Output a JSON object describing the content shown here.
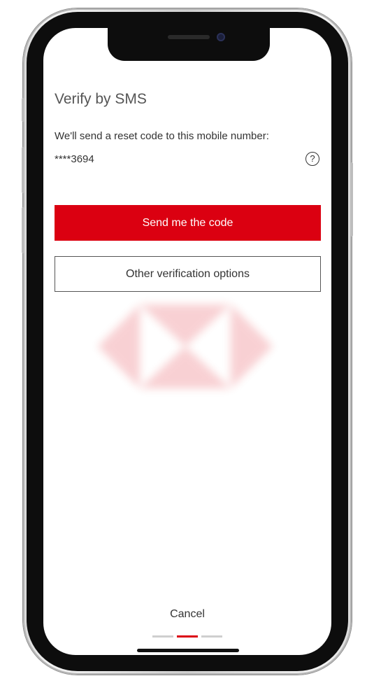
{
  "screen": {
    "title": "Verify by SMS",
    "subtitle": "We'll send a reset code to this mobile number:",
    "masked_number": "****3694",
    "help_icon_glyph": "?",
    "primary_button_label": "Send me the code",
    "secondary_button_label": "Other verification options",
    "cancel_label": "Cancel"
  },
  "pager": {
    "total": 3,
    "active_index": 1
  },
  "colors": {
    "brand_red": "#db0011",
    "text_dark": "#333333",
    "title_gray": "#555555",
    "pager_inactive": "#cfcfcf"
  },
  "icons": {
    "help": "help-circle-icon",
    "watermark": "hexagon-logo-watermark"
  }
}
